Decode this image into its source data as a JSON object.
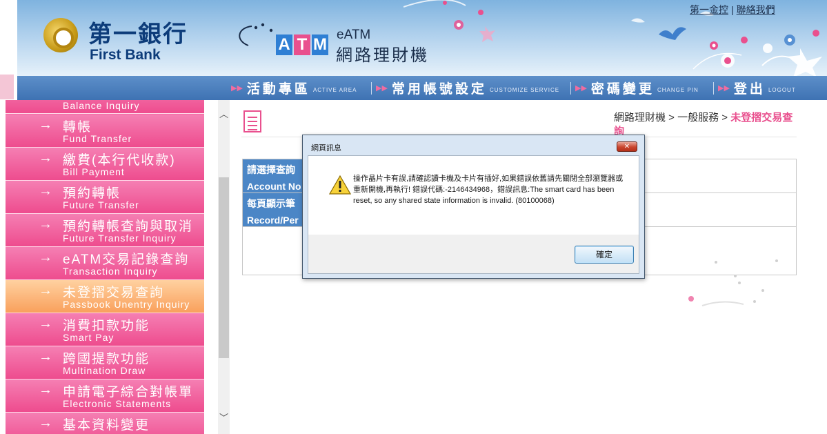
{
  "header": {
    "brand_zh": "第一銀行",
    "brand_en": "First Bank",
    "atm_letters": [
      "A",
      "T",
      "M"
    ],
    "eatm_title": "eATM",
    "eatm_subtitle": "網路理財機",
    "links": [
      "第一金控",
      "聯絡我們"
    ]
  },
  "nav": [
    {
      "zh": "活動專區",
      "en": "ACTIVE AREA"
    },
    {
      "zh": "常用帳號設定",
      "en": "CUSTOMIZE SERVICE"
    },
    {
      "zh": "密碼變更",
      "en": "CHANGE PIN"
    },
    {
      "zh": "登出",
      "en": "LOGOUT"
    }
  ],
  "sidebar": {
    "items": [
      {
        "zh": "",
        "en": "Balance Inquiry",
        "active": false
      },
      {
        "zh": "轉帳",
        "en": "Fund Transfer",
        "active": false
      },
      {
        "zh": "繳費(本行代收款)",
        "en": "Bill Payment",
        "active": false
      },
      {
        "zh": "預約轉帳",
        "en": "Future Transfer",
        "active": false
      },
      {
        "zh": "預約轉帳查詢與取消",
        "en": "Future Transfer Inquiry",
        "active": false
      },
      {
        "zh": "eATM交易記錄查詢",
        "en": "Transaction Inquiry",
        "active": false
      },
      {
        "zh": "未登摺交易查詢",
        "en": "Passbook Unentry Inquiry",
        "active": true
      },
      {
        "zh": "消費扣款功能",
        "en": "Smart Pay",
        "active": false
      },
      {
        "zh": "跨國提款功能",
        "en": "Multination Draw",
        "active": false
      },
      {
        "zh": "申請電子綜合對帳單",
        "en": "Electronic Statements",
        "active": false
      },
      {
        "zh": "基本資料變更",
        "en": "",
        "active": false
      }
    ]
  },
  "breadcrumb": {
    "path": "網路理財機 > 一般服務 >",
    "current": "未登摺交易查詢"
  },
  "form": {
    "rows": [
      {
        "zh": "請選擇查詢",
        "en": "Account No"
      },
      {
        "zh": "每頁顯示筆",
        "en": "Record/Per"
      }
    ]
  },
  "dialog": {
    "title": "網頁訊息",
    "close_glyph": "✕",
    "message_zh": "操作晶片卡有誤,請確認讀卡機及卡片有插好,如果錯誤依舊請先關閉全部瀏覽器或重新開機,再執行! 錯誤代碼:-2146434968，錯誤訊息:The smart card has been reset, so any shared state information is invalid. (80100068)",
    "ok_label": "確定",
    "icon": "warning-icon"
  },
  "colors": {
    "brand_blue": "#0d3c7a",
    "nav_blue": "#3e72b3",
    "sidebar_pink": "#ee4c8e",
    "active_orange": "#f9a05c",
    "form_label_blue": "#4b86c6"
  }
}
